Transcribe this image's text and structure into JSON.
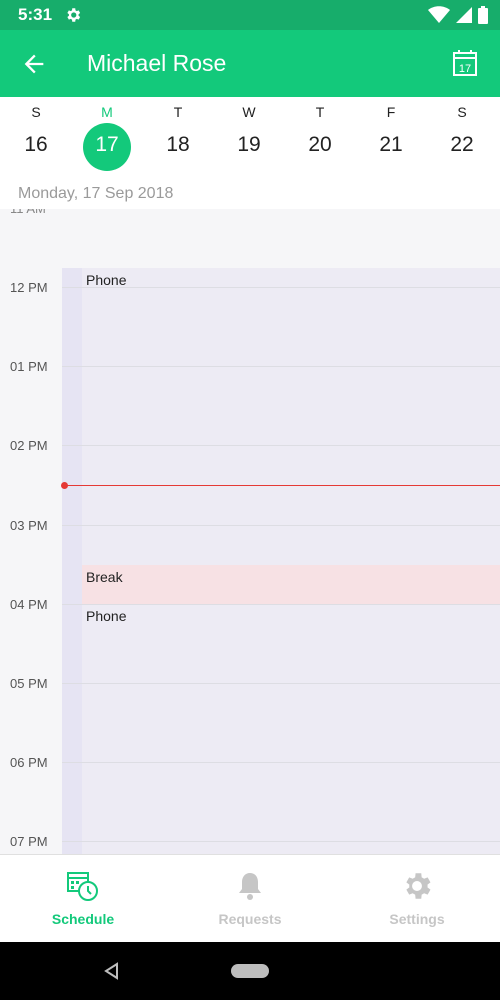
{
  "status_bar": {
    "time": "5:31"
  },
  "app_bar": {
    "title": "Michael Rose",
    "calendar_day": "17"
  },
  "week": [
    {
      "dow": "S",
      "num": "16"
    },
    {
      "dow": "M",
      "num": "17",
      "selected": true
    },
    {
      "dow": "T",
      "num": "18"
    },
    {
      "dow": "W",
      "num": "19"
    },
    {
      "dow": "T",
      "num": "20"
    },
    {
      "dow": "F",
      "num": "21"
    },
    {
      "dow": "S",
      "num": "22"
    }
  ],
  "selected_date": "Monday, 17 Sep 2018",
  "schedule": {
    "hours": [
      "12 PM",
      "01 PM",
      "02 PM",
      "03 PM",
      "04 PM",
      "05 PM",
      "06 PM",
      "07 PM"
    ],
    "events": [
      {
        "label": "Phone"
      },
      {
        "label": "Break"
      },
      {
        "label": "Phone"
      }
    ]
  },
  "bottom_nav": {
    "schedule": "Schedule",
    "requests": "Requests",
    "settings": "Settings"
  },
  "colors": {
    "primary": "#13c97b",
    "status_bar": "#17ad6b",
    "now_line": "#e53935",
    "break_event": "#f7e1e4"
  }
}
